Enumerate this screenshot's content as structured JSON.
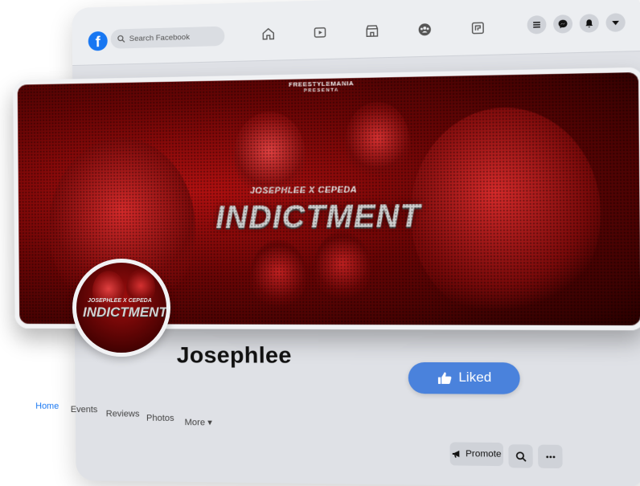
{
  "colors": {
    "accent": "#1877f2",
    "liked_button": "#4a82dc",
    "window_bg": "#dfe1e6"
  },
  "topbar": {
    "search_placeholder": "Search Facebook",
    "nav_icons": [
      "home-icon",
      "video-icon",
      "marketplace-icon",
      "groups-icon",
      "gaming-icon"
    ],
    "right_icons": [
      "menu-icon",
      "messenger-icon",
      "notifications-icon",
      "account-dropdown-icon"
    ]
  },
  "cover": {
    "brand": "FREESTYLEMANIA",
    "brand_sub": "PRESENTA",
    "artists": "JOSEPHLEE X CEPEDA",
    "title": "INDICTMENT"
  },
  "avatar": {
    "artists": "JOSEPHLEE X CEPEDA",
    "title": "INDICTMENT"
  },
  "profile": {
    "name": "Josephlee",
    "liked_label": "Liked"
  },
  "tabs": [
    {
      "label": "Home",
      "active": true
    },
    {
      "label": "Events",
      "active": false
    },
    {
      "label": "Reviews",
      "active": false
    },
    {
      "label": "Photos",
      "active": false
    },
    {
      "label": "More ▾",
      "active": false
    }
  ],
  "actions": {
    "promote_label": "Promote"
  }
}
